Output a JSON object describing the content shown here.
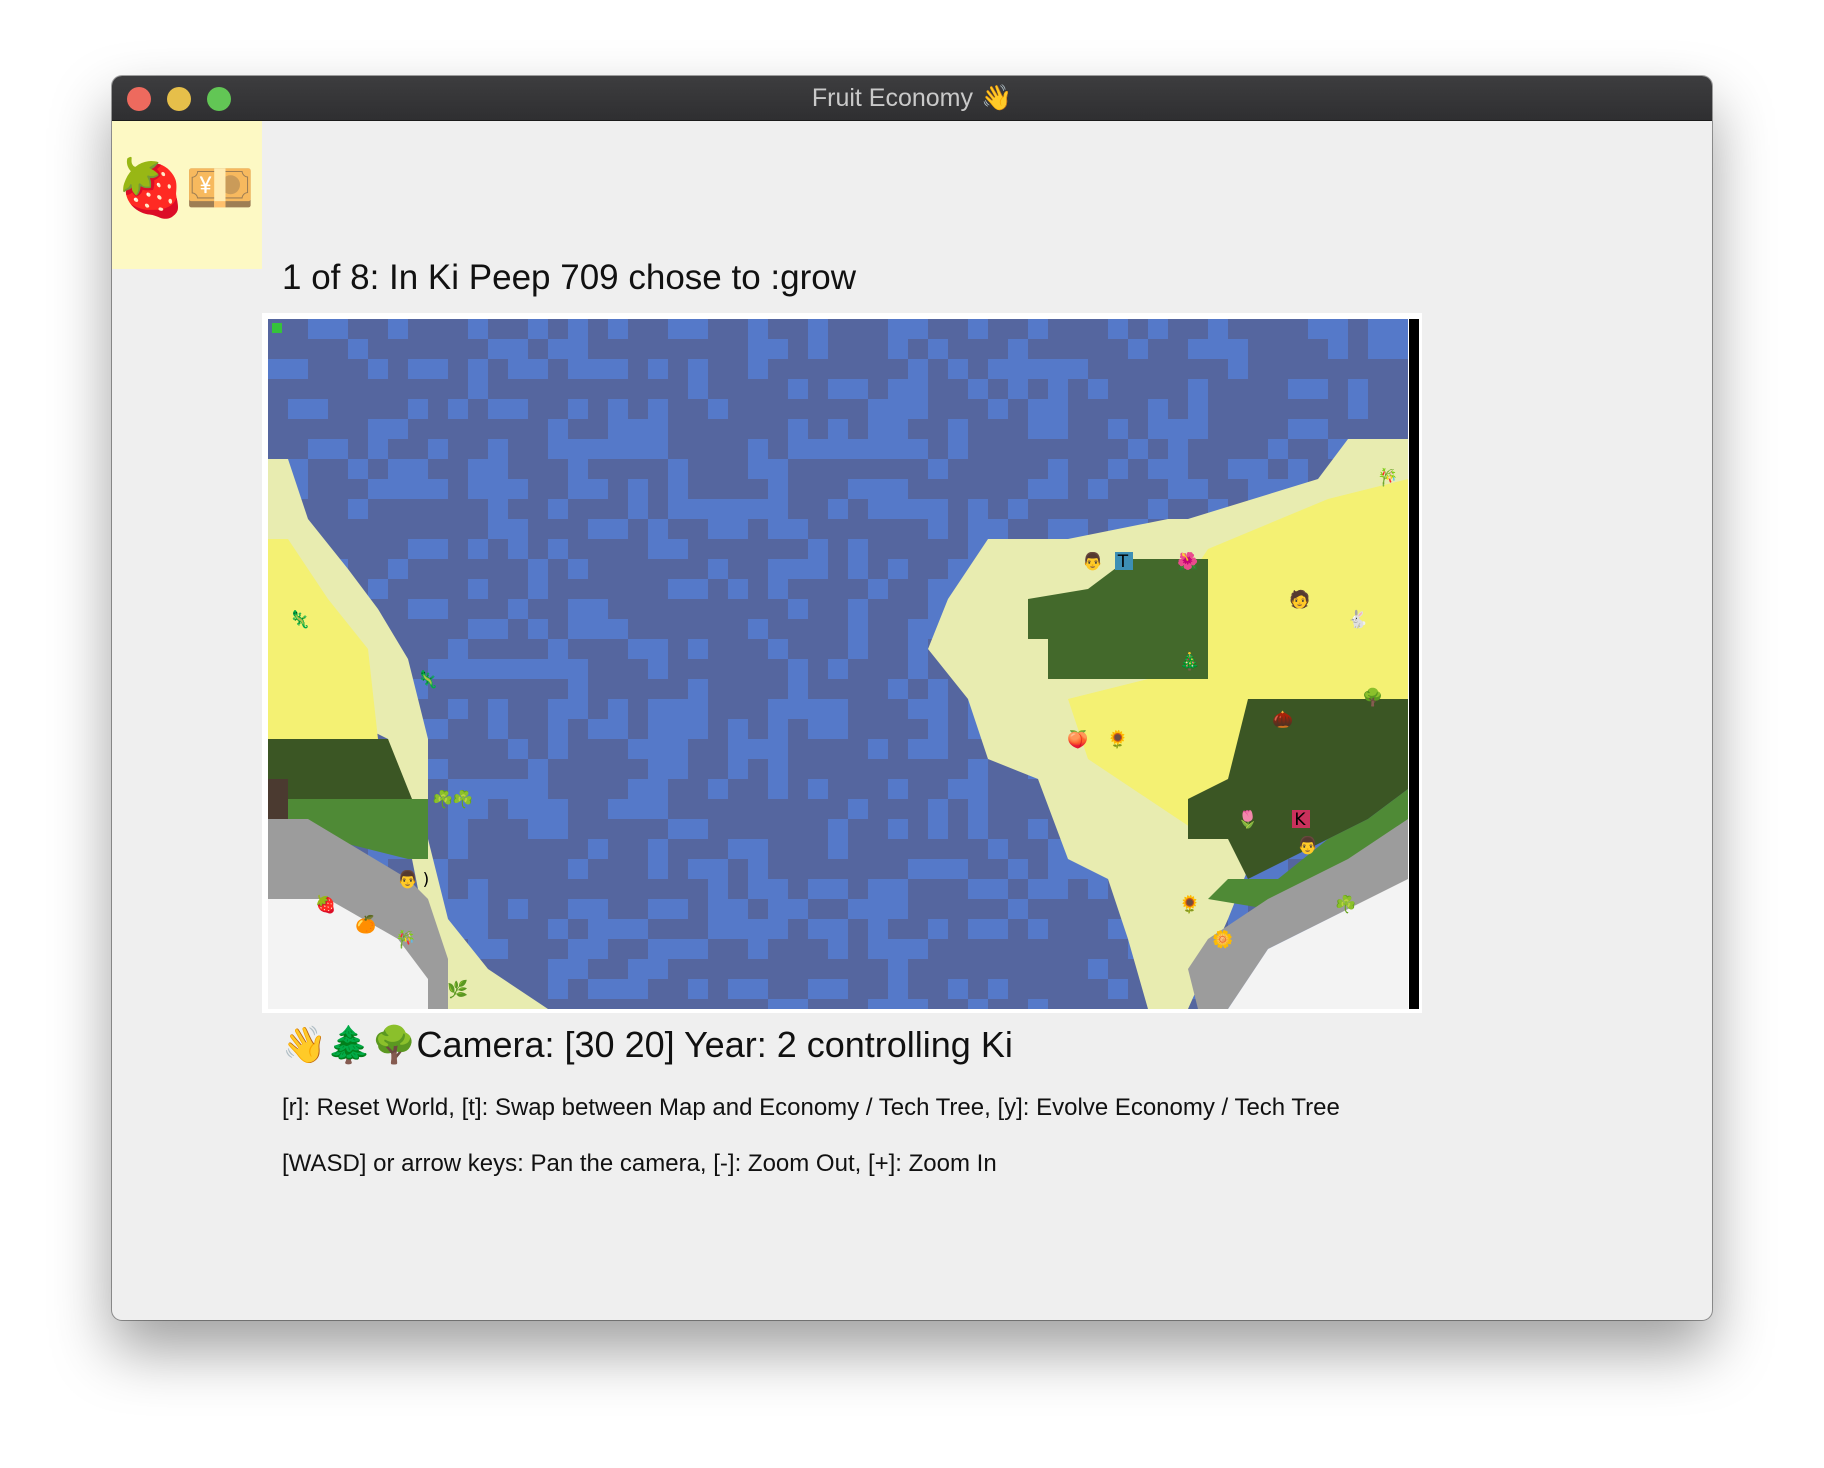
{
  "window": {
    "title": "Fruit Economy",
    "title_icon": "👋"
  },
  "toolbar": {
    "items": [
      {
        "icon": "strawberry-icon",
        "glyph": "🍓"
      },
      {
        "icon": "yen-banknote-icon",
        "glyph": "💴"
      }
    ]
  },
  "status": "1 of 8: In Ki Peep 709 chose to :grow",
  "map": {
    "colors": {
      "deep_water": "#55669f",
      "shallow_water": "#5579c9",
      "beach": "#e8ecb0",
      "sand": "#f4f173",
      "grass": "#4f8a36",
      "forest": "#43692b",
      "dense_forest": "#3b5624",
      "rock": "#9c9c9c",
      "snow": "#f3f3f3",
      "dirt": "#4b3a30",
      "marker": "#35c23b"
    },
    "tiles": [
      {
        "glyph": "🎋"
      },
      {
        "glyph": "🌺"
      },
      {
        "glyph": "🦎"
      },
      {
        "glyph": "🐇"
      },
      {
        "glyph": "🦎"
      },
      {
        "glyph": "🎄"
      },
      {
        "glyph": "🌳"
      },
      {
        "glyph": "🌰"
      },
      {
        "glyph": "🍑"
      },
      {
        "glyph": "🌻"
      },
      {
        "glyph": "☘️"
      },
      {
        "glyph": "☘️"
      },
      {
        "glyph": "🌷"
      },
      {
        "glyph": "🍓"
      },
      {
        "glyph": "🍊"
      },
      {
        "glyph": "🎋"
      },
      {
        "glyph": "🌻"
      },
      {
        "glyph": "☘️"
      },
      {
        "glyph": "🌼"
      },
      {
        "glyph": "🌿"
      },
      {
        "glyph": "👨"
      },
      {
        "glyph": "T"
      },
      {
        "glyph": "🧑"
      },
      {
        "glyph": "K"
      },
      {
        "glyph": "👨"
      },
      {
        "glyph": "👨"
      },
      {
        "glyph": ")"
      }
    ]
  },
  "camera": {
    "icons": [
      "👋",
      "🌲",
      "🌳"
    ],
    "text": "Camera: [30 20] Year: 2 controlling Ki"
  },
  "help": {
    "line1": "[r]: Reset World, [t]: Swap between Map and Economy / Tech Tree, [y]: Evolve Economy / Tech Tree",
    "line2": "[WASD] or arrow keys: Pan the camera, [-]: Zoom Out, [+]: Zoom In"
  }
}
